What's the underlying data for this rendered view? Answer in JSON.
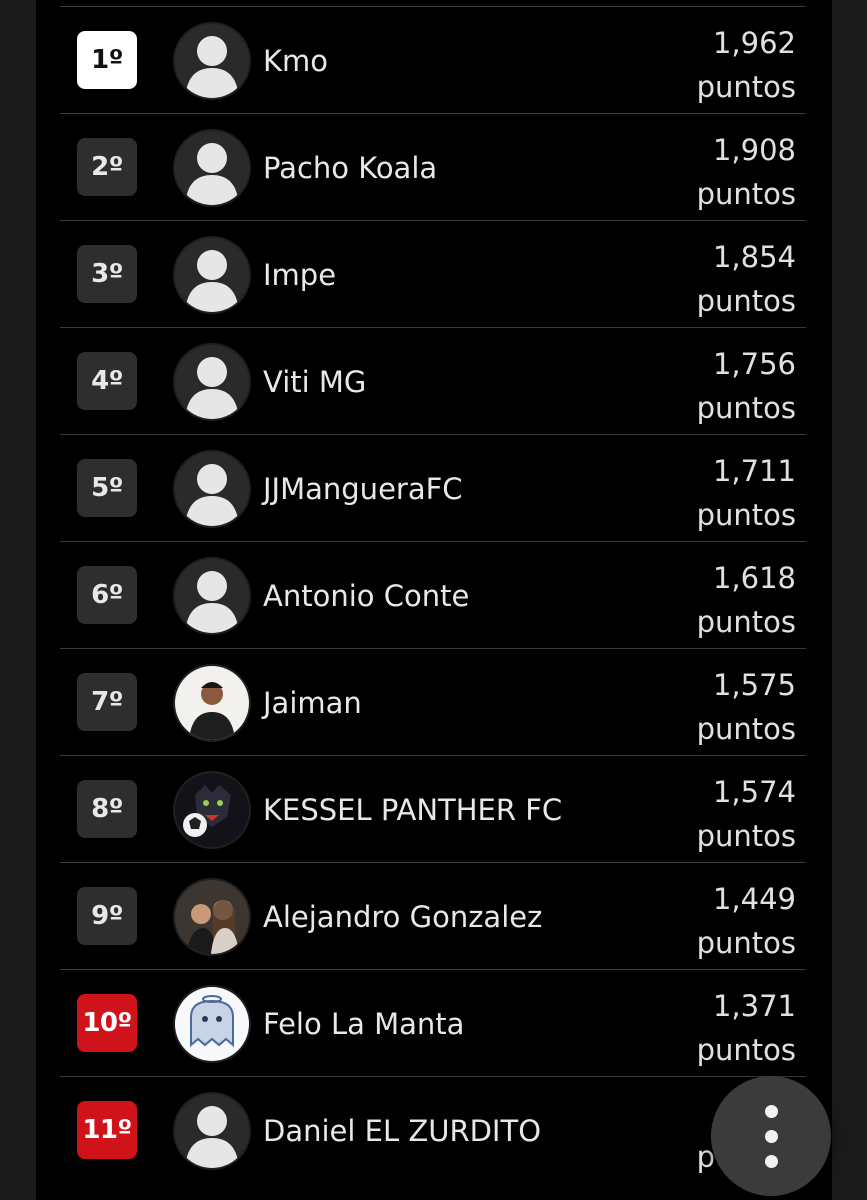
{
  "leaderboard": [
    {
      "rank": "1º",
      "name": "Kmo",
      "points": "1,962",
      "unit": "puntos",
      "rank_style": "first",
      "avatar": "default-avatar-icon"
    },
    {
      "rank": "2º",
      "name": "Pacho Koala",
      "points": "1,908",
      "unit": "puntos",
      "rank_style": "normal",
      "avatar": "default-avatar-icon"
    },
    {
      "rank": "3º",
      "name": "Impe",
      "points": "1,854",
      "unit": "puntos",
      "rank_style": "normal",
      "avatar": "default-avatar-icon"
    },
    {
      "rank": "4º",
      "name": "Viti MG",
      "points": "1,756",
      "unit": "puntos",
      "rank_style": "normal",
      "avatar": "default-avatar-icon"
    },
    {
      "rank": "5º",
      "name": "JJMangueraFC",
      "points": "1,711",
      "unit": "puntos",
      "rank_style": "normal",
      "avatar": "default-avatar-icon"
    },
    {
      "rank": "6º",
      "name": "Antonio Conte",
      "points": "1,618",
      "unit": "puntos",
      "rank_style": "normal",
      "avatar": "default-avatar-icon"
    },
    {
      "rank": "7º",
      "name": "Jaiman",
      "points": "1,575",
      "unit": "puntos",
      "rank_style": "normal",
      "avatar": "user-photo-avatar"
    },
    {
      "rank": "8º",
      "name": "KESSEL PANTHER FC",
      "points": "1,574",
      "unit": "puntos",
      "rank_style": "normal",
      "avatar": "panther-logo-avatar"
    },
    {
      "rank": "9º",
      "name": "Alejandro Gonzalez",
      "points": "1,449",
      "unit": "puntos",
      "rank_style": "normal",
      "avatar": "couple-photo-avatar"
    },
    {
      "rank": "10º",
      "name": "Felo La Manta",
      "points": "1,371",
      "unit": "puntos",
      "rank_style": "red",
      "avatar": "ghost-drawing-avatar"
    },
    {
      "rank": "11º",
      "name": "Daniel EL ZURDITO",
      "points": "",
      "unit": "puntos",
      "rank_style": "red",
      "avatar": "default-avatar-icon"
    }
  ],
  "fab": {
    "icon": "more-vertical-icon"
  }
}
